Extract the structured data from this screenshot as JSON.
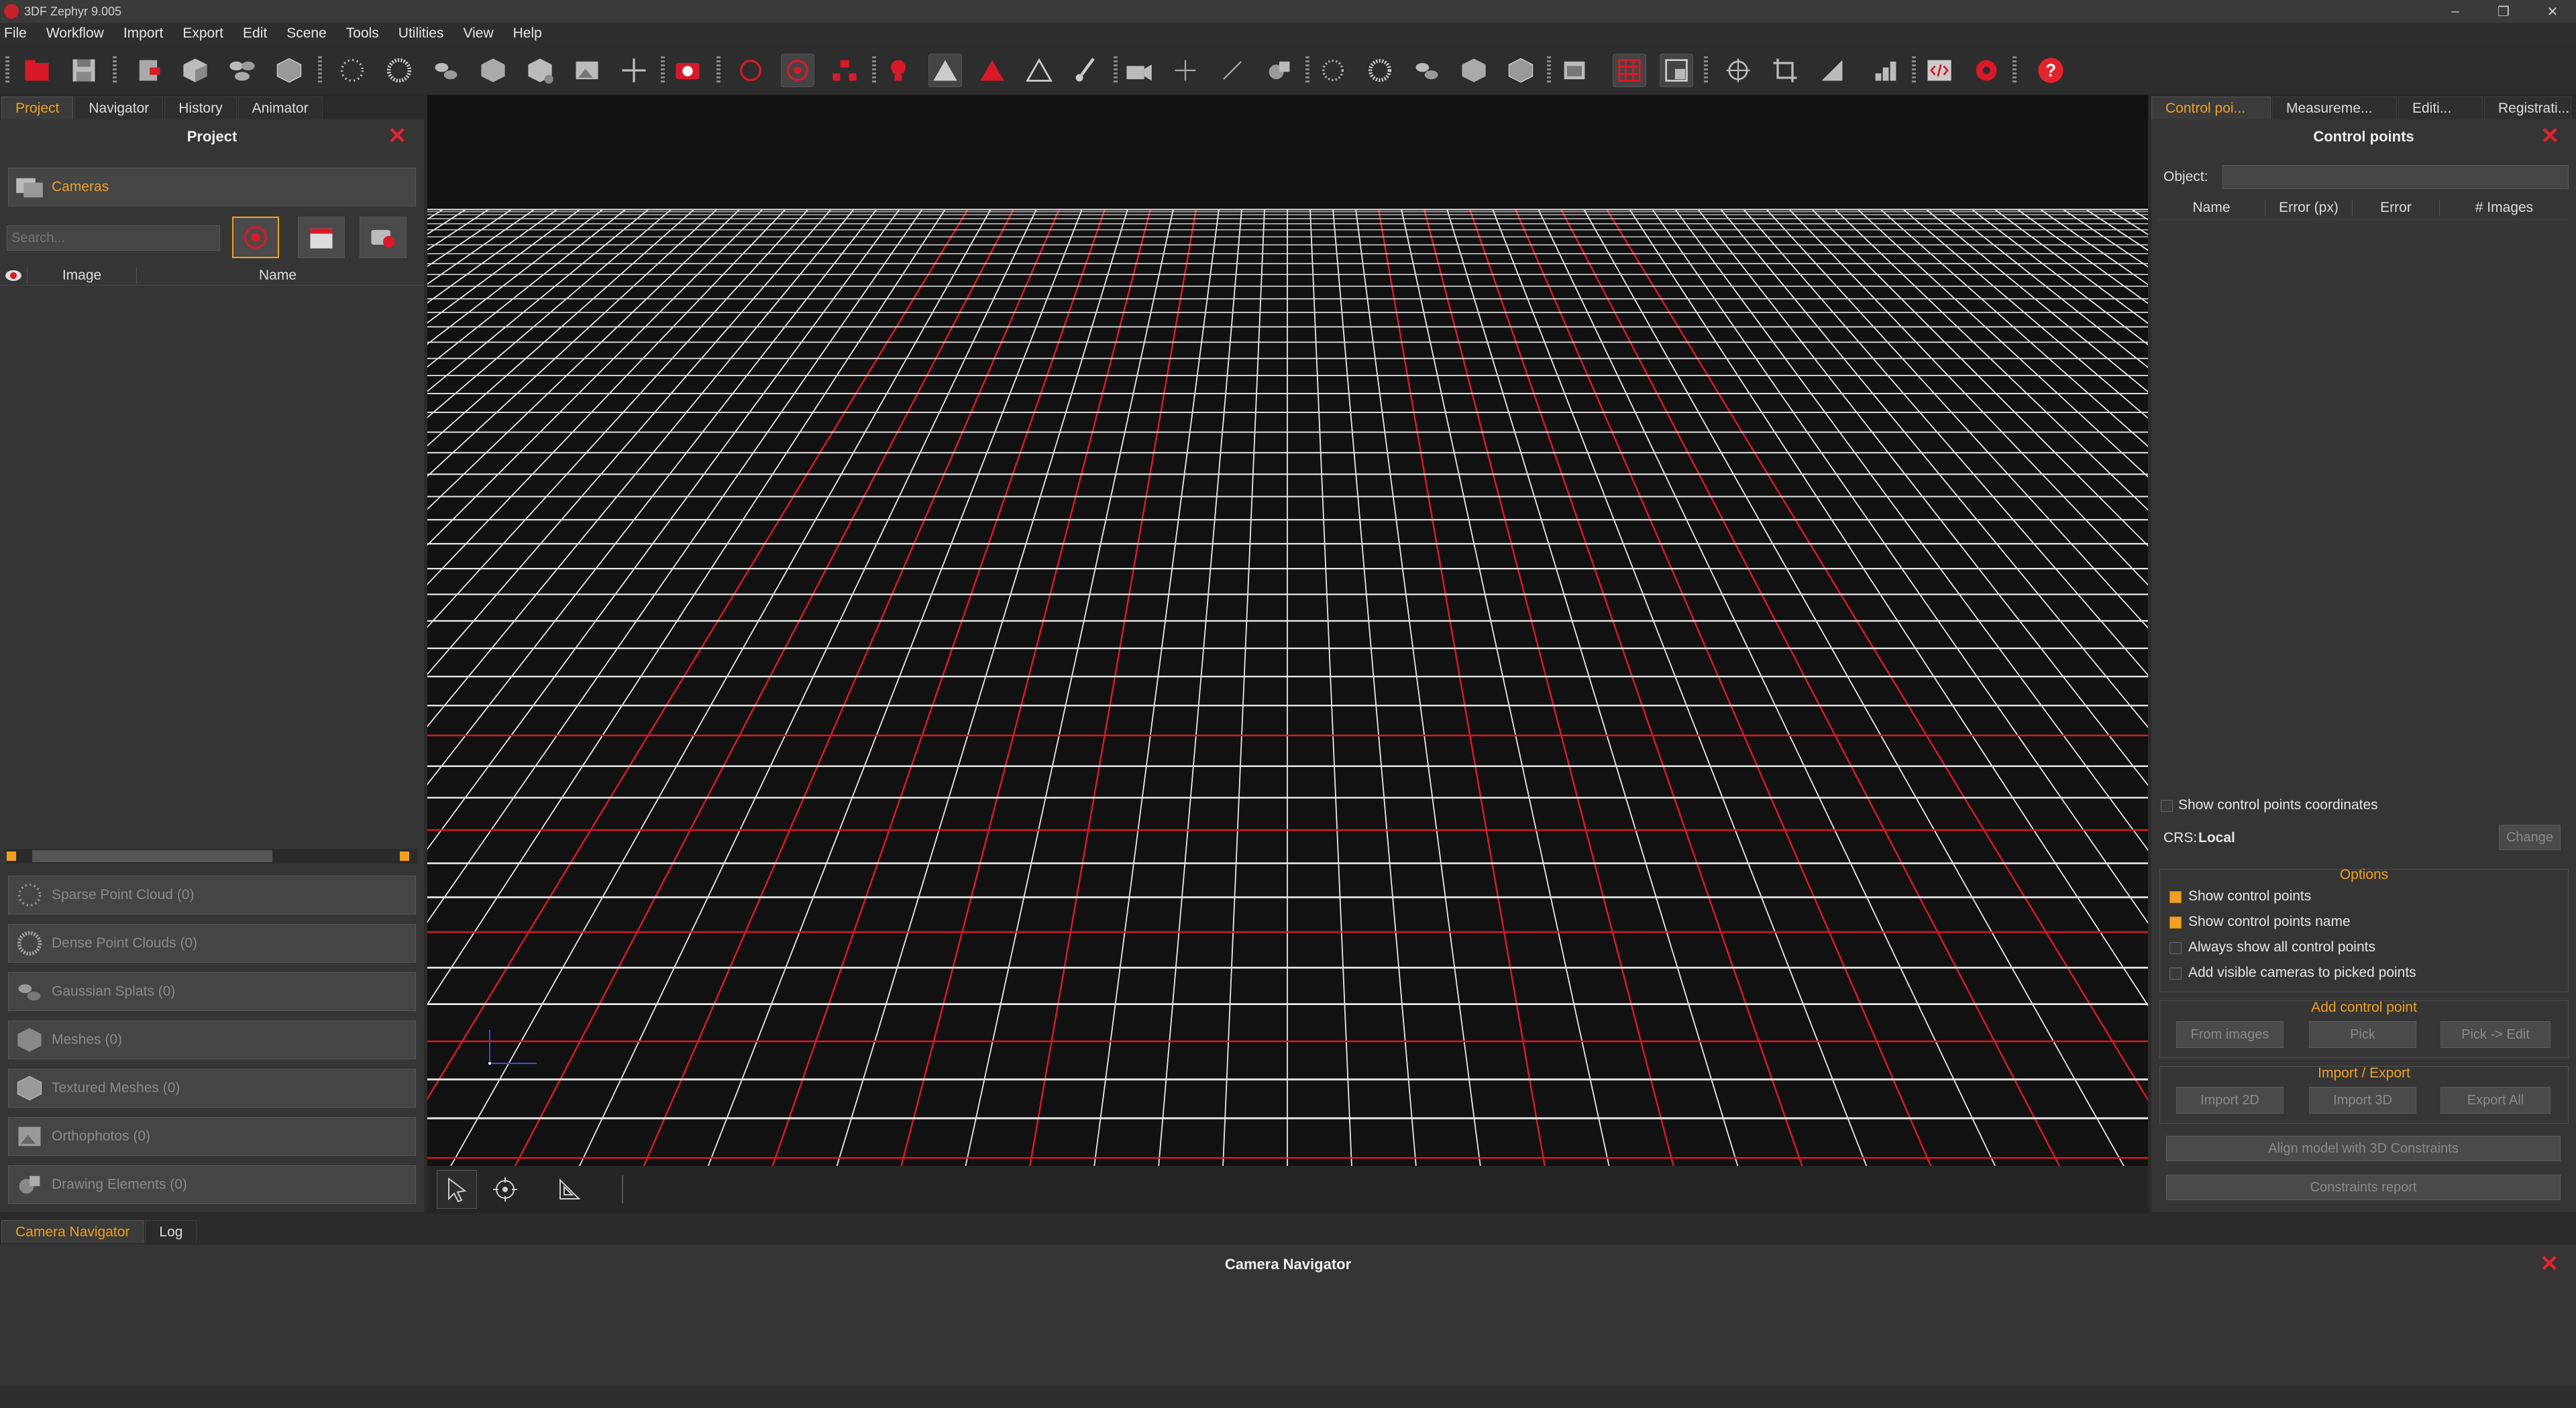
{
  "app": {
    "title": "3DF Zephyr 9.005"
  },
  "window_controls": {
    "minimize": "–",
    "restore": "❐",
    "close": "✕"
  },
  "menu": [
    "File",
    "Workflow",
    "Import",
    "Export",
    "Edit",
    "Scene",
    "Tools",
    "Utilities",
    "View",
    "Help"
  ],
  "toolbar_icons": [
    "new-project-icon",
    "save-icon",
    "export-icon",
    "cube-icon",
    "splat-icon",
    "mesh-icon",
    "sparse-cloud-icon",
    "dense-cloud-icon",
    "gaussian-splats-icon",
    "textured-mesh-icon",
    "mesh-filter-icon",
    "image-icon",
    "move-icon",
    "camera-icon",
    "rotate-icon",
    "orbit-icon",
    "network-icon",
    "light-icon",
    "solid-triangle-icon",
    "red-triangle-icon",
    "wire-triangle-icon",
    "brush-icon",
    "video-camera-icon",
    "pivot-icon",
    "measure-line-icon",
    "shape-icon",
    "point-cloud-icon",
    "point-cloud-2-icon",
    "splat-view-icon",
    "mesh-view-icon",
    "textured-view-icon",
    "viewport-icon",
    "grid-icon",
    "grid-settings-icon",
    "gizmo-icon",
    "crop-icon",
    "ruler-icon",
    "chart-icon",
    "script-icon",
    "gear-icon",
    "help-icon"
  ],
  "left": {
    "tabs": [
      "Project",
      "Navigator",
      "History",
      "Animator"
    ],
    "selected_tab": 0,
    "panel_title": "Project",
    "cameras_label": "Cameras",
    "search_placeholder": "Search...",
    "columns": [
      "Image",
      "Name"
    ],
    "categories": [
      "Sparse Point Cloud (0)",
      "Dense Point Clouds (0)",
      "Gaussian Splats (0)",
      "Meshes (0)",
      "Textured Meshes (0)",
      "Orthophotos (0)",
      "Drawing Elements (0)"
    ]
  },
  "right": {
    "tabs": [
      "Control poi...",
      "Measureme...",
      "Editi...",
      "Registrati..."
    ],
    "selected_tab": 0,
    "panel_title": "Control points",
    "object_label": "Object:",
    "columns": [
      "Name",
      "Error (px)",
      "Error",
      "# Images"
    ],
    "show_coords_label": "Show control points coordinates",
    "crs_label": "CRS:",
    "crs_value": "Local",
    "change_button": "Change",
    "options_title": "Options",
    "options": [
      {
        "label": "Show control points",
        "checked": true
      },
      {
        "label": "Show control points name",
        "checked": true
      },
      {
        "label": "Always show all control points",
        "checked": false
      },
      {
        "label": "Add visible cameras to picked points",
        "checked": false
      }
    ],
    "add_title": "Add control point",
    "add_buttons": [
      "From images",
      "Pick",
      "Pick -> Edit"
    ],
    "io_title": "Import / Export",
    "io_buttons": [
      "Import 2D",
      "Import 3D",
      "Export All"
    ],
    "align_button": "Align model with 3D Constraints",
    "report_button": "Constraints report"
  },
  "bottom": {
    "tabs": [
      "Camera Navigator",
      "Log"
    ],
    "selected_tab": 0,
    "panel_title": "Camera Navigator"
  },
  "colors": {
    "accent": "#f0a020",
    "brand_red": "#e3222e",
    "grid_white": "#e8e8e8",
    "grid_red": "#d8192a"
  }
}
